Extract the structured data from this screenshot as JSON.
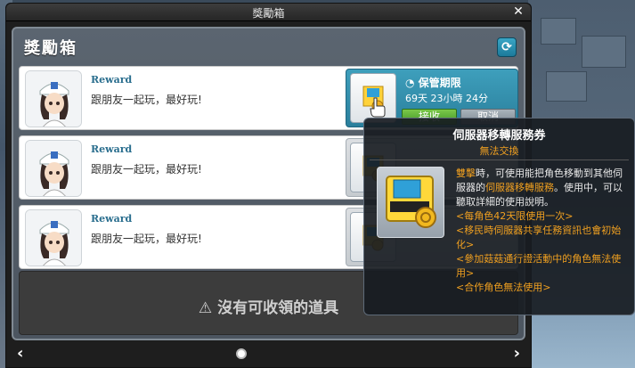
{
  "window": {
    "title": "獎勵箱",
    "close_label": "✕"
  },
  "panel": {
    "title": "獎勵箱",
    "refresh_icon": "refresh-icon"
  },
  "rewards": [
    {
      "title": "Reward",
      "message": "跟朋友一起玩，最好玩!",
      "expire_label": "保管期限",
      "expire_value": "69天 23小時 24分",
      "accept_label": "接收",
      "cancel_label": "取消",
      "selected": true
    },
    {
      "title": "Reward",
      "message": "跟朋友一起玩，最好玩!"
    },
    {
      "title": "Reward",
      "message": "跟朋友一起玩，最好玩!"
    }
  ],
  "empty_slot": {
    "text": "沒有可收領的道具",
    "icon": "warning-icon"
  },
  "pager": {
    "prev": "‹",
    "next": "›"
  },
  "tooltip": {
    "title": "伺服器移轉服務券",
    "subtitle": "無法交換",
    "body_lead": "雙擊",
    "body_part1": "時，可使用能把角色移動到其他伺服器的",
    "body_hl": "伺服器移轉服務",
    "body_part2": "。使用中，可以聽取詳細的使用說明。",
    "notes": [
      "<每角色42天限使用一次>",
      "<移民時伺服器共享任務資訊也會初始化>",
      "<參加菇菇通行證活動中的角色無法使用>",
      "<合作角色無法使用>"
    ]
  },
  "colors": {
    "accent": "#2a7f9c",
    "highlight": "#f0a020",
    "accept": "#3f9626"
  }
}
